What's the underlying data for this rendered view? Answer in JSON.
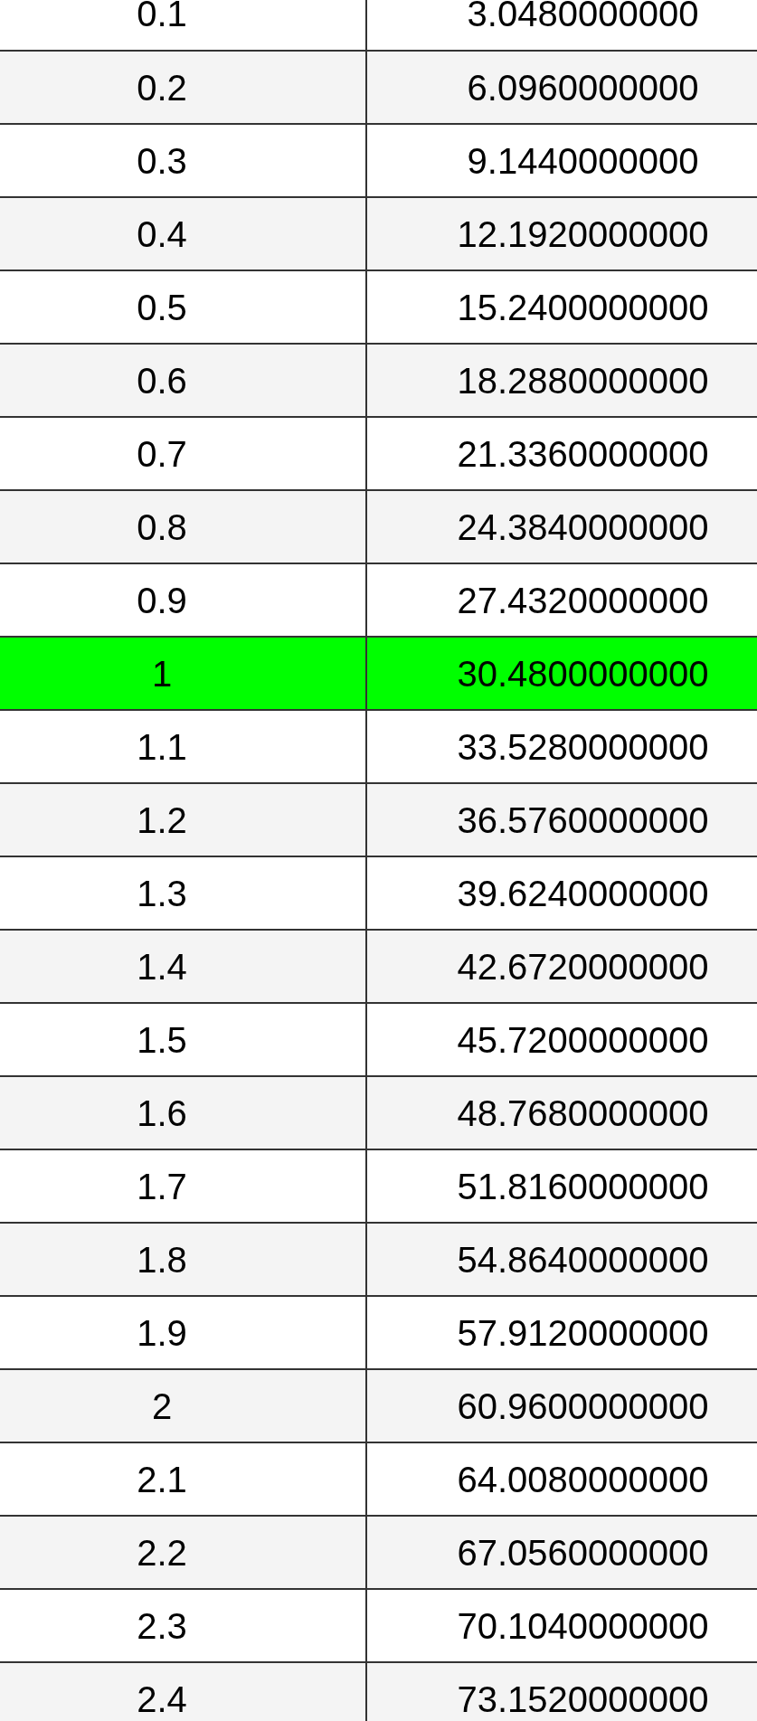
{
  "table": {
    "rows": [
      {
        "cells": [
          "0.1",
          "3.0480000000"
        ],
        "selected": false
      },
      {
        "cells": [
          "0.2",
          "6.0960000000"
        ],
        "selected": false
      },
      {
        "cells": [
          "0.3",
          "9.1440000000"
        ],
        "selected": false
      },
      {
        "cells": [
          "0.4",
          "12.1920000000"
        ],
        "selected": false
      },
      {
        "cells": [
          "0.5",
          "15.2400000000"
        ],
        "selected": false
      },
      {
        "cells": [
          "0.6",
          "18.2880000000"
        ],
        "selected": false
      },
      {
        "cells": [
          "0.7",
          "21.3360000000"
        ],
        "selected": false
      },
      {
        "cells": [
          "0.8",
          "24.3840000000"
        ],
        "selected": false
      },
      {
        "cells": [
          "0.9",
          "27.4320000000"
        ],
        "selected": false
      },
      {
        "cells": [
          "1",
          "30.4800000000"
        ],
        "selected": true
      },
      {
        "cells": [
          "1.1",
          "33.5280000000"
        ],
        "selected": false
      },
      {
        "cells": [
          "1.2",
          "36.5760000000"
        ],
        "selected": false
      },
      {
        "cells": [
          "1.3",
          "39.6240000000"
        ],
        "selected": false
      },
      {
        "cells": [
          "1.4",
          "42.6720000000"
        ],
        "selected": false
      },
      {
        "cells": [
          "1.5",
          "45.7200000000"
        ],
        "selected": false
      },
      {
        "cells": [
          "1.6",
          "48.7680000000"
        ],
        "selected": false
      },
      {
        "cells": [
          "1.7",
          "51.8160000000"
        ],
        "selected": false
      },
      {
        "cells": [
          "1.8",
          "54.8640000000"
        ],
        "selected": false
      },
      {
        "cells": [
          "1.9",
          "57.9120000000"
        ],
        "selected": false
      },
      {
        "cells": [
          "2",
          "60.9600000000"
        ],
        "selected": false
      },
      {
        "cells": [
          "2.1",
          "64.0080000000"
        ],
        "selected": false
      },
      {
        "cells": [
          "2.2",
          "67.0560000000"
        ],
        "selected": false
      },
      {
        "cells": [
          "2.3",
          "70.1040000000"
        ],
        "selected": false
      },
      {
        "cells": [
          "2.4",
          "73.1520000000"
        ],
        "selected": false
      }
    ]
  }
}
